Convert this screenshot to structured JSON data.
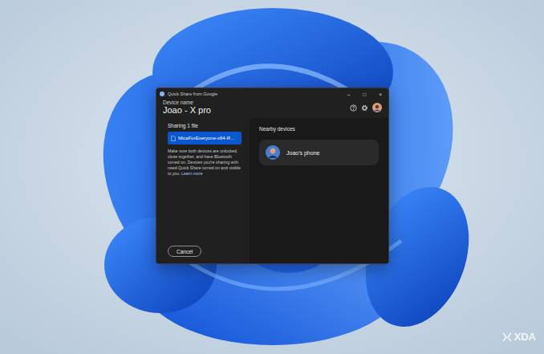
{
  "window": {
    "title": "Quick Share from Google",
    "controls": [
      "–",
      "□",
      "×"
    ]
  },
  "device": {
    "label": "Device name",
    "name": "Joao - X pro"
  },
  "sharing": {
    "heading": "Sharing 1 file",
    "file": "MicaForEveryone-x64-R…",
    "hint": "Make sure both devices are unlocked, close together, and have Bluetooth turned on. Devices you're sharing with need Quick Share turned on and visible to you.",
    "link": "Learn more"
  },
  "nearby": {
    "heading": "Nearby devices",
    "devices": [
      {
        "name": "Joao's phone"
      }
    ]
  },
  "buttons": [
    "Cancel"
  ],
  "watermark": "XDA"
}
